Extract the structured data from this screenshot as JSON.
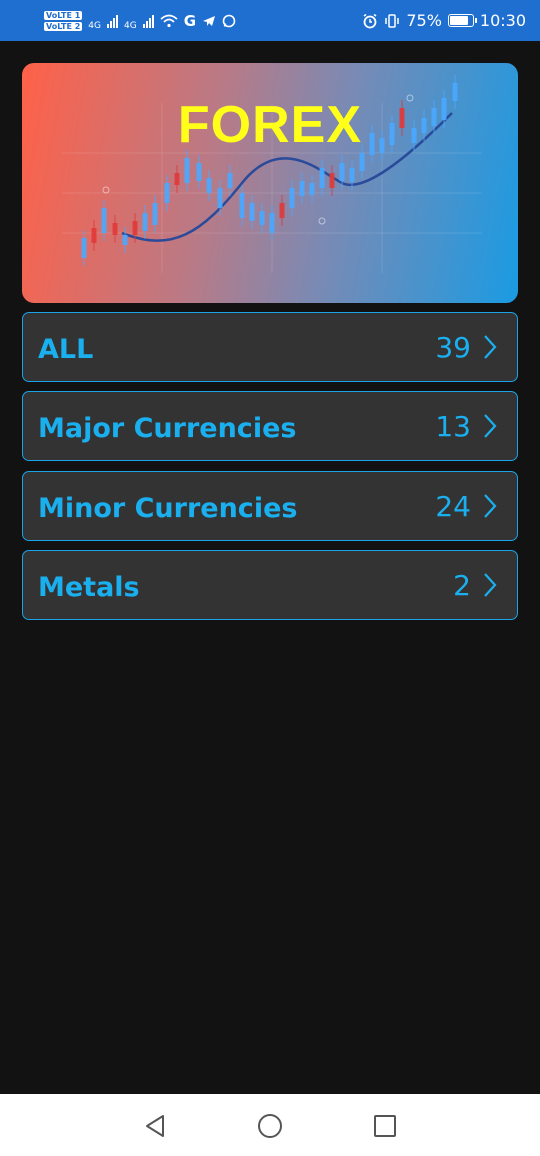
{
  "status_bar": {
    "volte1": "VoLTE 1",
    "volte2": "VoLTE 2",
    "net1": "4G",
    "net2": "4G",
    "carrier_icon": "G",
    "battery": "75%",
    "time": "10:30"
  },
  "banner": {
    "title": "FOREX"
  },
  "categories": [
    {
      "label": "ALL",
      "count": "39"
    },
    {
      "label": "Major Currencies",
      "count": "13"
    },
    {
      "label": "Minor Currencies",
      "count": "24"
    },
    {
      "label": "Metals",
      "count": "2"
    }
  ],
  "nav": {
    "back_icon": "triangle-back-icon",
    "home_icon": "circle-home-icon",
    "recents_icon": "square-recents-icon"
  },
  "colors": {
    "accent": "#1ab0f0",
    "title_yellow": "#ffff1a",
    "status_bar": "#1f6fd1",
    "card_bg": "#333333",
    "page_bg": "#121212"
  }
}
